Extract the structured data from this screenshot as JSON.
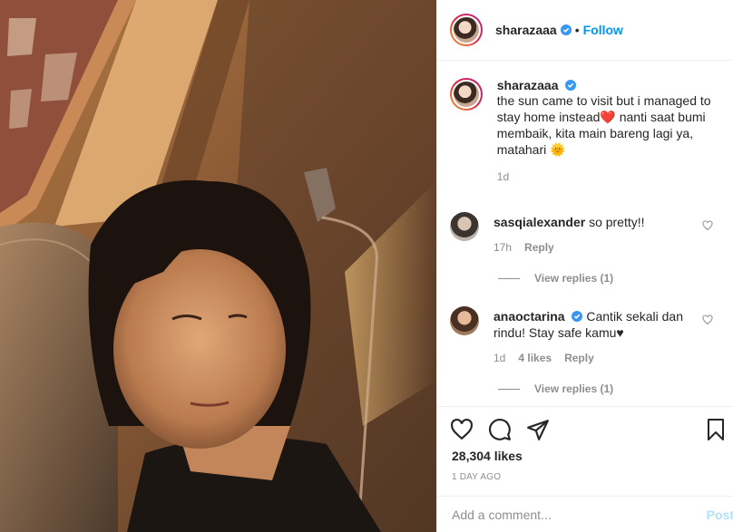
{
  "post": {
    "username": "sharazaaa",
    "follow_label": "Follow",
    "dot": "•",
    "image_alt": "selfie in sunlight"
  },
  "caption": {
    "username": "sharazaaa",
    "text": "the sun came to visit but i managed to stay home instead❤️ nanti saat bumi membaik, kita main bareng lagi ya, matahari 🌞",
    "time": "1d"
  },
  "comments": [
    {
      "username": "sasqialexander",
      "text": "so pretty!!",
      "time": "17h",
      "likes": "",
      "reply_label": "Reply",
      "view_replies": "View replies (1)"
    },
    {
      "username": "anaoctarina",
      "text": "Cantik sekali dan rindu! Stay safe kamu♥",
      "time": "1d",
      "likes": "4 likes",
      "reply_label": "Reply",
      "view_replies": "View replies (1)"
    }
  ],
  "stats": {
    "likes": "28,304 likes",
    "ago": "1 DAY AGO"
  },
  "composer": {
    "placeholder": "Add a comment...",
    "post_label": "Post"
  },
  "colors": {
    "link": "#0095f6",
    "verified": "#3897f0",
    "muted": "#8e8e8e"
  }
}
